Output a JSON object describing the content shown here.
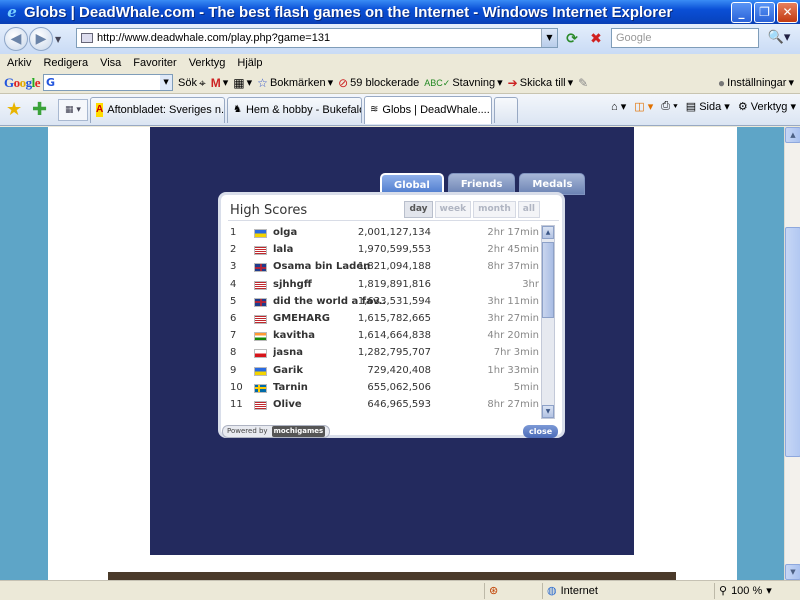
{
  "window": {
    "title": "Globs | DeadWhale.com - The best flash games on the Internet - Windows Internet Explorer",
    "minimize": "_",
    "maximize": "❐",
    "close": "✕"
  },
  "address": {
    "url": "http://www.deadwhale.com/play.php?game=131",
    "search_placeholder": "Google"
  },
  "menu": [
    "Arkiv",
    "Redigera",
    "Visa",
    "Favoriter",
    "Verktyg",
    "Hjälp"
  ],
  "google_toolbar": {
    "search_label": "Sök",
    "bookmarks": "Bokmärken",
    "blocked": "59 blockerade",
    "spelling": "Stavning",
    "send_to": "Skicka till",
    "settings": "Inställningar"
  },
  "tabs": [
    {
      "label": "Aftonbladet: Sveriges n...",
      "active": false
    },
    {
      "label": "Hem & hobby - Bukefalos",
      "active": false
    },
    {
      "label": "Globs | DeadWhale....",
      "active": true
    }
  ],
  "command_bar": {
    "page": "Sida",
    "tools": "Verktyg"
  },
  "highscores": {
    "tabs": [
      "Global",
      "Friends",
      "Medals"
    ],
    "title": "High Scores",
    "filters": [
      "day",
      "week",
      "month",
      "all"
    ],
    "rows": [
      {
        "rank": "1",
        "flag": "ua",
        "name": "olga",
        "score": "2,001,127,134",
        "time": "2hr 17min"
      },
      {
        "rank": "2",
        "flag": "us",
        "name": "lala",
        "score": "1,970,599,553",
        "time": "2hr 45min"
      },
      {
        "rank": "3",
        "flag": "gb",
        "name": "Osama bin Laden",
        "score": "1,821,094,188",
        "time": "8hr 37min"
      },
      {
        "rank": "4",
        "flag": "us",
        "name": "sjhhgff",
        "score": "1,819,891,816",
        "time": "3hr"
      },
      {
        "rank": "5",
        "flag": "gb",
        "name": "did the world a fav...",
        "score": "1,633,531,594",
        "time": "3hr 11min"
      },
      {
        "rank": "6",
        "flag": "us",
        "name": "GMEHARG",
        "score": "1,615,782,665",
        "time": "3hr 27min"
      },
      {
        "rank": "7",
        "flag": "in",
        "name": "kavitha",
        "score": "1,614,664,838",
        "time": "4hr 20min"
      },
      {
        "rank": "8",
        "flag": "cz",
        "name": "jasna",
        "score": "1,282,795,707",
        "time": "7hr 3min"
      },
      {
        "rank": "9",
        "flag": "ua",
        "name": "Garik",
        "score": "729,420,408",
        "time": "1hr 33min"
      },
      {
        "rank": "10",
        "flag": "se",
        "name": "Tarnin",
        "score": "655,062,506",
        "time": "5min"
      },
      {
        "rank": "11",
        "flag": "us",
        "name": "Olive",
        "score": "646,965,593",
        "time": "8hr 27min"
      }
    ],
    "powered_by": "Powered by",
    "powered_brand": "mochigames",
    "close_label": "close"
  },
  "status": {
    "zone": "Internet",
    "zoom": "100 %"
  },
  "colors": {
    "game_bg": "#232a5e",
    "page_side": "#5ea5c7"
  }
}
